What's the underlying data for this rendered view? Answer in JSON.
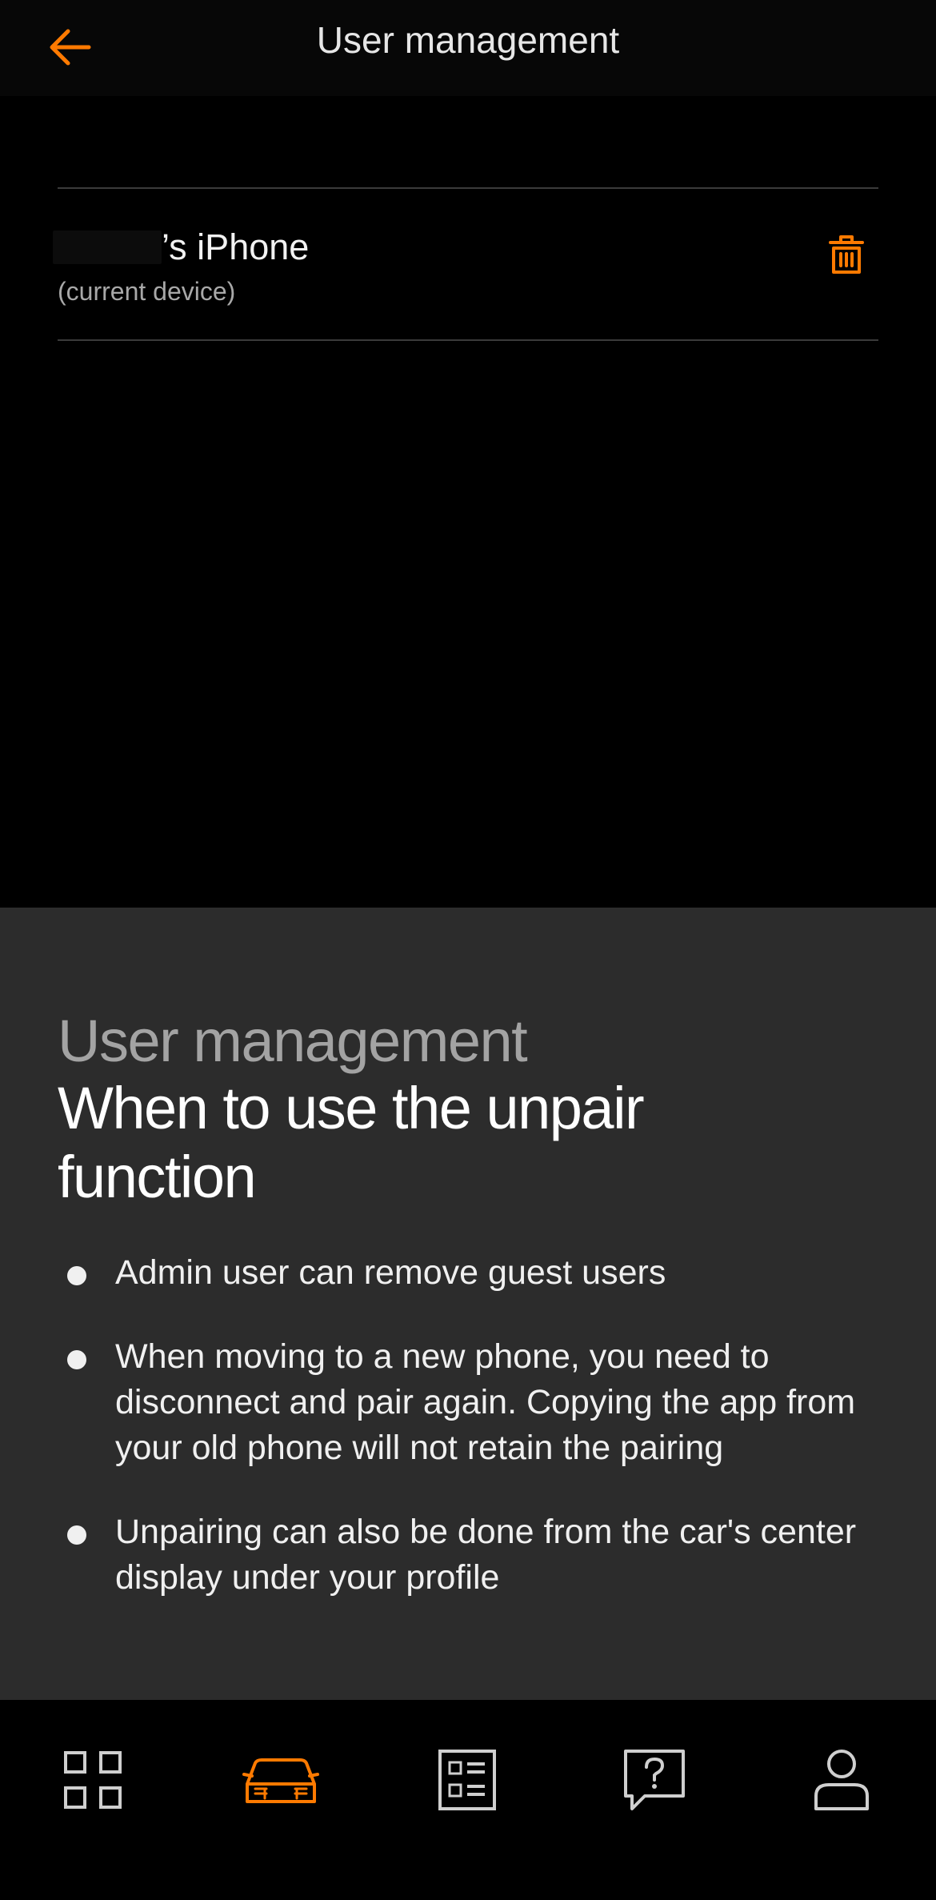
{
  "header": {
    "title": "User management",
    "back_icon": "arrow-left-icon"
  },
  "device": {
    "name": "’s iPhone",
    "subtitle": "(current device)",
    "delete_icon": "trash-icon"
  },
  "info": {
    "kicker": "User management",
    "title": "When to use the unpair function",
    "bullets": [
      "Admin user can remove guest users",
      "When moving to a new phone, you need to disconnect and pair again. Copying the app from your old phone will not retain the pairing",
      "Unpairing can also be done from the car's center display under your profile"
    ]
  },
  "nav": {
    "items": [
      {
        "icon": "grid-icon",
        "active": false
      },
      {
        "icon": "car-icon",
        "active": true
      },
      {
        "icon": "list-icon",
        "active": false
      },
      {
        "icon": "help-chat-icon",
        "active": false
      },
      {
        "icon": "profile-icon",
        "active": false
      }
    ]
  },
  "colors": {
    "accent": "#ff7a00",
    "background": "#000000",
    "panel": "#2c2c2c",
    "nav_icon": "#cfcfcf"
  }
}
